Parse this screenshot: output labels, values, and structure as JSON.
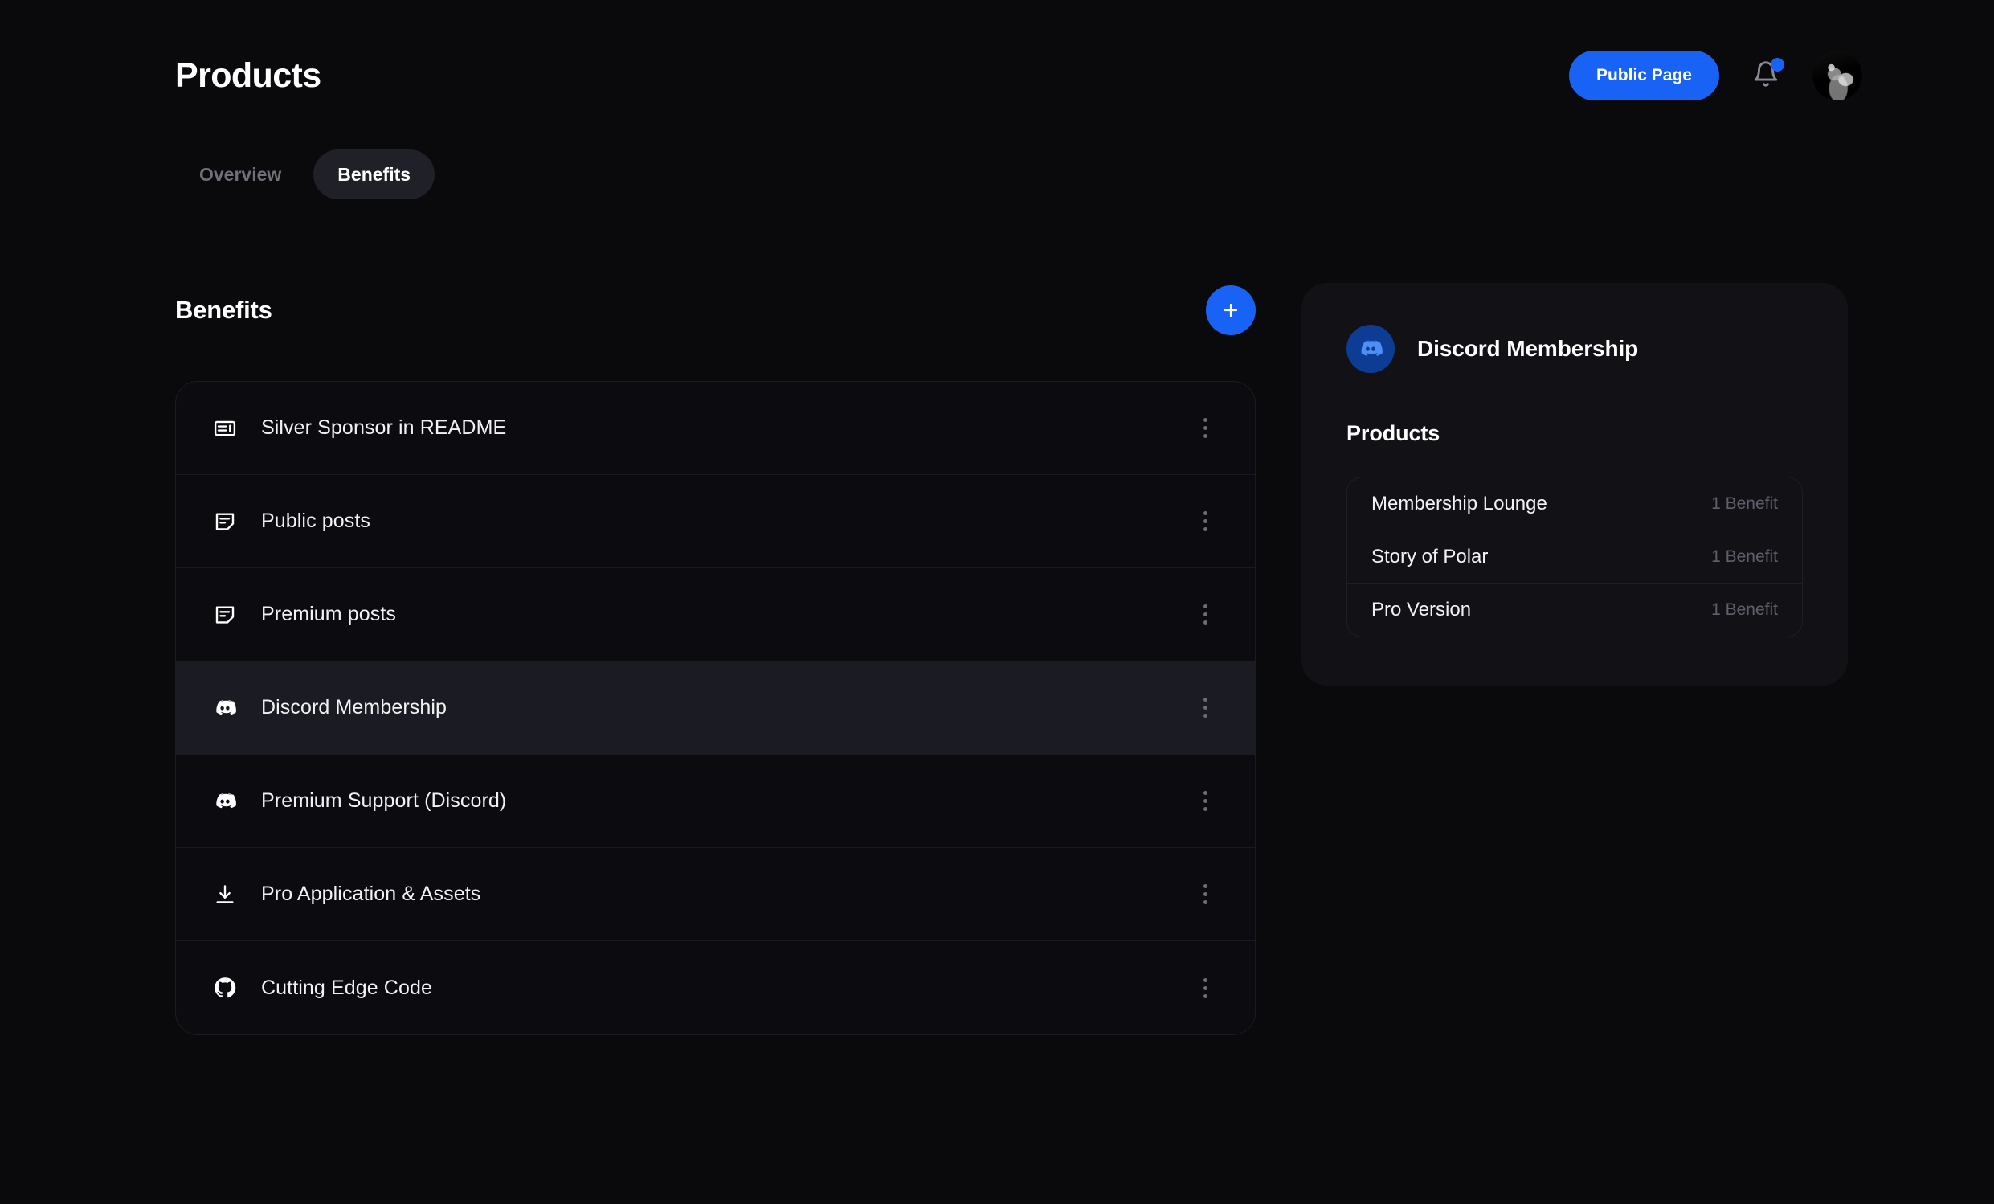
{
  "header": {
    "title": "Products",
    "public_page_label": "Public Page",
    "bell_icon": "bell-icon",
    "has_notification_dot": true,
    "avatar": "user-avatar"
  },
  "tabs": [
    {
      "label": "Overview",
      "active": false
    },
    {
      "label": "Benefits",
      "active": true
    }
  ],
  "benefits_section": {
    "title": "Benefits",
    "add_label": "+",
    "items": [
      {
        "label": "Silver Sponsor in README",
        "icon": "ad-banner-icon",
        "selected": false
      },
      {
        "label": "Public posts",
        "icon": "article-note-icon",
        "selected": false
      },
      {
        "label": "Premium posts",
        "icon": "article-note-icon",
        "selected": false
      },
      {
        "label": "Discord Membership",
        "icon": "discord-icon",
        "selected": true
      },
      {
        "label": "Premium Support (Discord)",
        "icon": "discord-icon",
        "selected": false
      },
      {
        "label": "Pro Application & Assets",
        "icon": "download-icon",
        "selected": false
      },
      {
        "label": "Cutting Edge Code",
        "icon": "github-icon",
        "selected": false
      }
    ]
  },
  "detail_panel": {
    "badge_icon": "discord-icon",
    "title": "Discord Membership",
    "subtitle": "Products",
    "products": [
      {
        "name": "Membership Lounge",
        "count": "1 Benefit"
      },
      {
        "name": "Story of Polar",
        "count": "1 Benefit"
      },
      {
        "name": "Pro Version",
        "count": "1 Benefit"
      }
    ]
  },
  "colors": {
    "page_background": "#0a0a0d",
    "accent_blue": "#1862f5",
    "panel_background": "#121216",
    "selected_row": "#1b1b24",
    "muted_text": "#5f606b",
    "discord_badge_bg": "#0c3c94"
  }
}
